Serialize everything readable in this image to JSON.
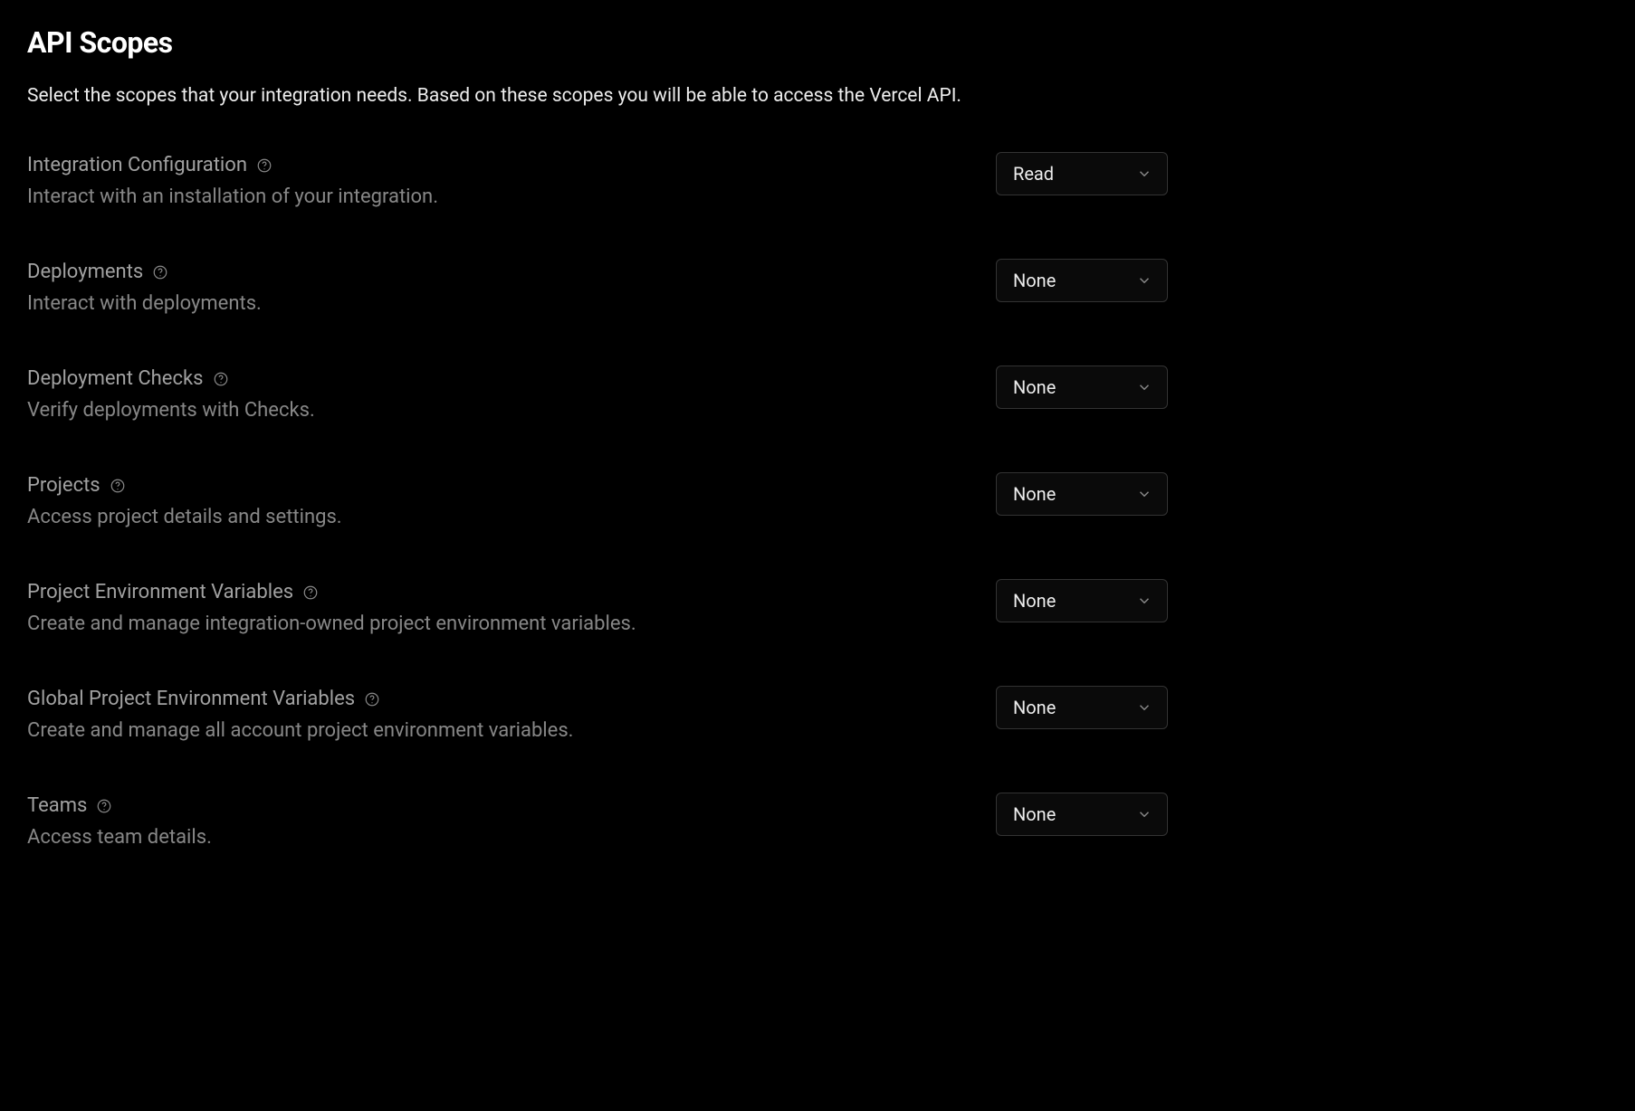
{
  "header": {
    "title": "API Scopes",
    "description": "Select the scopes that your integration needs. Based on these scopes you will be able to access the Vercel API."
  },
  "scopes": [
    {
      "id": "integration-configuration",
      "title": "Integration Configuration",
      "description": "Interact with an installation of your integration.",
      "value": "Read"
    },
    {
      "id": "deployments",
      "title": "Deployments",
      "description": "Interact with deployments.",
      "value": "None"
    },
    {
      "id": "deployment-checks",
      "title": "Deployment Checks",
      "description": "Verify deployments with Checks.",
      "value": "None"
    },
    {
      "id": "projects",
      "title": "Projects",
      "description": "Access project details and settings.",
      "value": "None"
    },
    {
      "id": "project-env-vars",
      "title": "Project Environment Variables",
      "description": "Create and manage integration-owned project environment variables.",
      "value": "None"
    },
    {
      "id": "global-project-env-vars",
      "title": "Global Project Environment Variables",
      "description": "Create and manage all account project environment variables.",
      "value": "None"
    },
    {
      "id": "teams",
      "title": "Teams",
      "description": "Access team details.",
      "value": "None"
    }
  ]
}
